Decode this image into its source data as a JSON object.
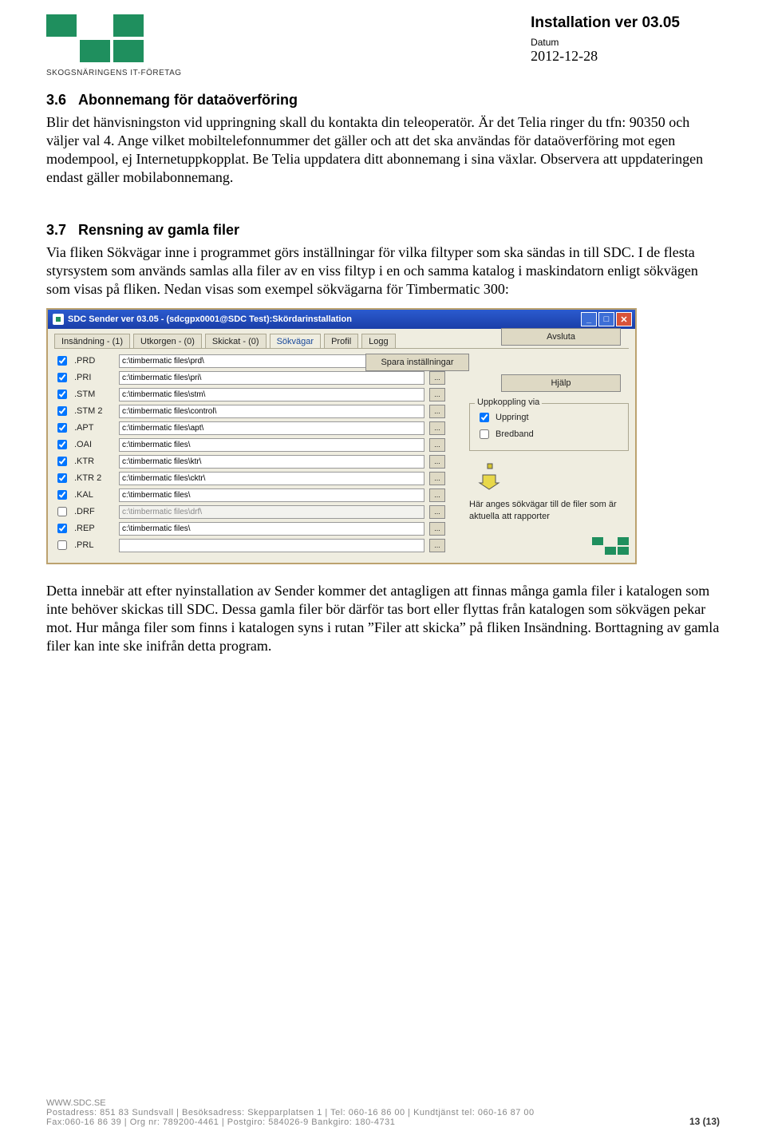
{
  "header": {
    "logo_sub": "SKOGSNÄRINGENS IT-FÖRETAG",
    "doc_title": "Installation ver 03.05",
    "datum_label": "Datum",
    "datum_value": "2012-12-28"
  },
  "section36": {
    "num": "3.6",
    "title": "Abonnemang för dataöverföring",
    "body": "Blir det hänvisningston vid uppringning skall du kontakta din teleoperatör. Är det Telia ringer du tfn: 90350 och väljer val 4. Ange vilket mobiltelefonnummer det gäller och att det ska användas för dataöverföring mot egen modempool, ej Internetuppkopplat. Be Telia uppdatera ditt abonnemang i sina växlar. Observera att uppdateringen endast gäller mobilabonnemang."
  },
  "section37": {
    "num": "3.7",
    "title": "Rensning av gamla filer",
    "body1": "Via fliken Sökvägar inne i programmet görs inställningar för vilka filtyper som ska sändas in till SDC. I de flesta styrsystem som används samlas alla filer av en viss filtyp i en och samma katalog i maskindatorn enligt sökvägen som visas på fliken. Nedan visas som exempel sökvägarna för Timbermatic 300:",
    "body2": "Detta innebär att efter nyinstallation av Sender kommer det antagligen att finnas många gamla filer i katalogen som inte behöver skickas till SDC. Dessa gamla filer bör därför tas bort eller flyttas från katalogen som sökvägen pekar mot. Hur många filer som finns i katalogen syns i rutan ”Filer att skicka” på fliken Insändning. Borttagning av gamla filer kan inte ske inifrån detta program."
  },
  "app": {
    "titlebar": "SDC Sender ver 03.05 - (sdcgpx0001@SDC Test):Skördarinstallation",
    "tabs": [
      "Insändning - (1)",
      "Utkorgen - (0)",
      "Skickat - (0)",
      "Sökvägar",
      "Profil",
      "Logg"
    ],
    "active_tab": 3,
    "spara": "Spara inställningar",
    "avsluta": "Avsluta",
    "hjalp": "Hjälp",
    "group_label": "Uppkoppling via",
    "uppringt": "Uppringt",
    "bredband": "Bredband",
    "hint": "Här anges sökvägar till de filer som är aktuella att rapporter",
    "rows": [
      {
        "chk": true,
        "ext": ".PRD",
        "path": "c:\\timbermatic files\\prd\\",
        "dis": false
      },
      {
        "chk": true,
        "ext": ".PRI",
        "path": "c:\\timbermatic files\\pri\\",
        "dis": false
      },
      {
        "chk": true,
        "ext": ".STM",
        "path": "c:\\timbermatic files\\stm\\",
        "dis": false
      },
      {
        "chk": true,
        "ext": ".STM 2",
        "path": "c:\\timbermatic files\\control\\",
        "dis": false
      },
      {
        "chk": true,
        "ext": ".APT",
        "path": "c:\\timbermatic files\\apt\\",
        "dis": false
      },
      {
        "chk": true,
        "ext": ".OAI",
        "path": "c:\\timbermatic files\\",
        "dis": false
      },
      {
        "chk": true,
        "ext": ".KTR",
        "path": "c:\\timbermatic files\\ktr\\",
        "dis": false
      },
      {
        "chk": true,
        "ext": ".KTR 2",
        "path": "c:\\timbermatic files\\cktr\\",
        "dis": false
      },
      {
        "chk": true,
        "ext": ".KAL",
        "path": "c:\\timbermatic files\\",
        "dis": false
      },
      {
        "chk": false,
        "ext": ".DRF",
        "path": "c:\\timbermatic files\\drf\\",
        "dis": true
      },
      {
        "chk": true,
        "ext": ".REP",
        "path": "c:\\timbermatic files\\",
        "dis": false
      },
      {
        "chk": false,
        "ext": ".PRL",
        "path": "",
        "dis": false
      }
    ]
  },
  "footer": {
    "url": "WWW.SDC.SE",
    "line1": "Postadress: 851 83 Sundsvall | Besöksadress: Skepparplatsen 1 | Tel: 060-16 86 00 | Kundtjänst tel: 060-16 87 00",
    "line2": "Fax:060-16 86 39 | Org nr: 789200-4461 | Postgiro: 584026-9 Bankgiro: 180-4731",
    "page": "13 (13)"
  }
}
